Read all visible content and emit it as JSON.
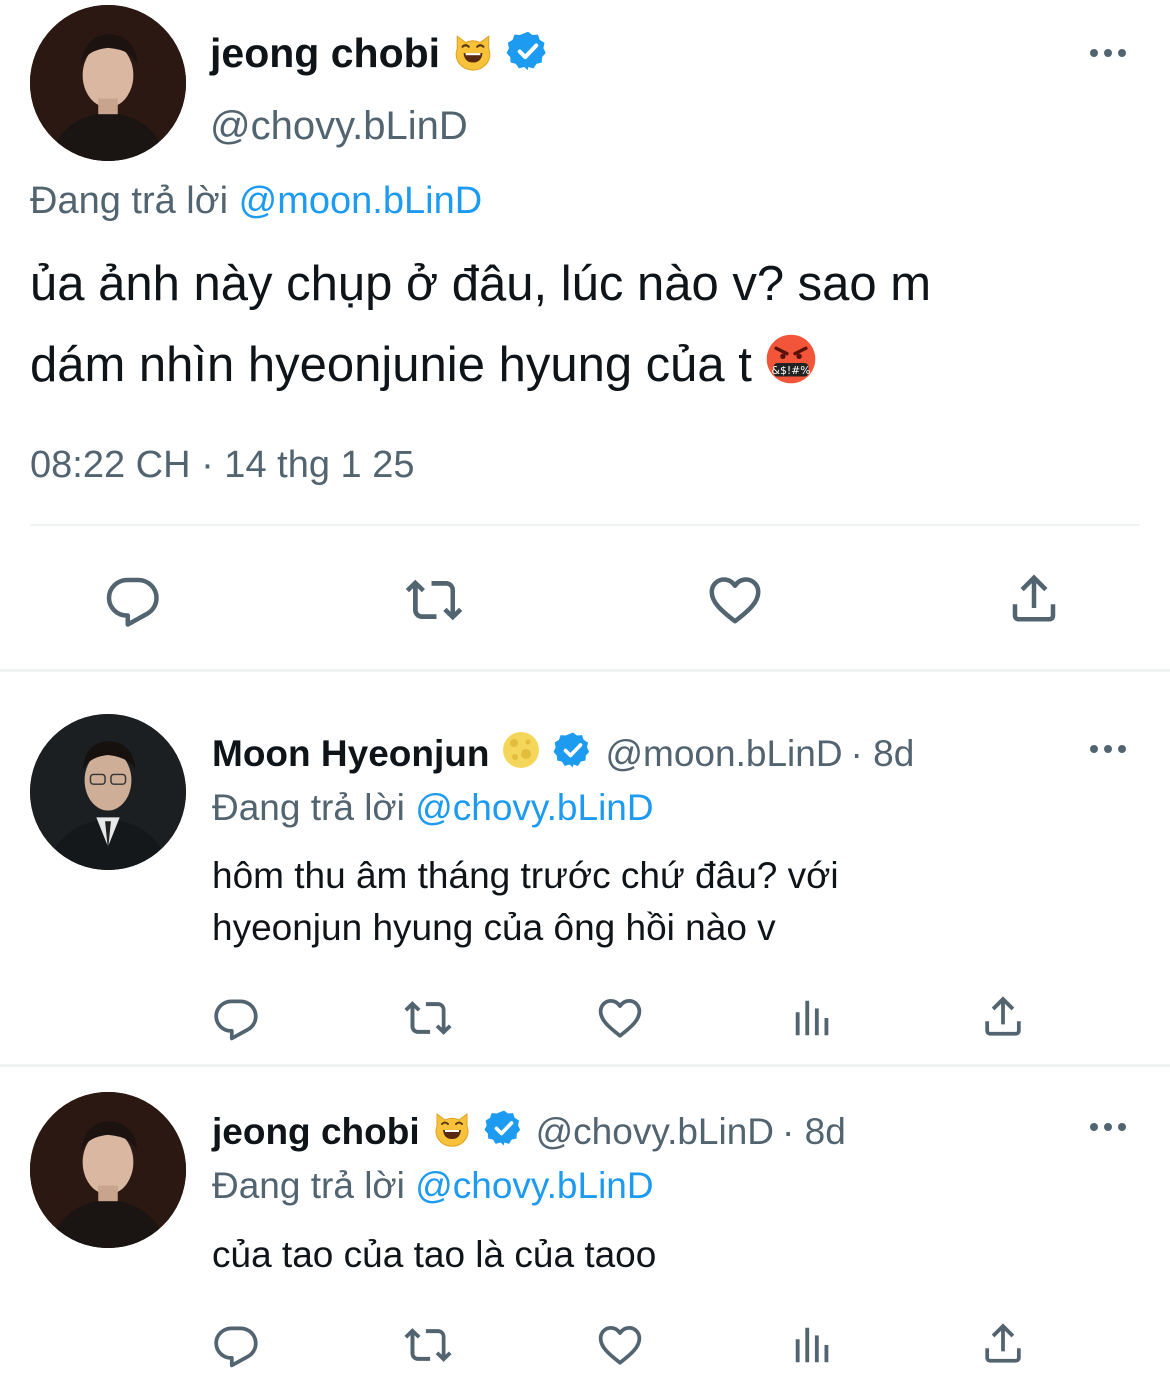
{
  "main_tweet": {
    "display_name": "jeong chobi",
    "name_emoji": "😺",
    "handle": "@chovy.bLinD",
    "reply_label": "Đang trả lời",
    "reply_to": "@moon.bLinD",
    "text_line1": "ủa ảnh này chụp ở đâu, lúc nào v? sao m",
    "text_line2": "dám nhìn hyeonjunie hyung của t",
    "text_emoji": "🤬",
    "timestamp": "08:22 CH · 14 thg 1 25"
  },
  "replies": [
    {
      "display_name": "Moon Hyeonjun",
      "name_emoji": "🌕",
      "handle": "@moon.bLinD",
      "age": "· 8d",
      "reply_label": "Đang trả lời",
      "reply_to": "@chovy.bLinD",
      "text_line1": "hôm thu âm tháng trước chứ đâu? với",
      "text_line2": "hyeonjun hyung của ông hồi nào v"
    },
    {
      "display_name": "jeong chobi",
      "name_emoji": "😺",
      "handle": "@chovy.bLinD",
      "age": "· 8d",
      "reply_label": "Đang trả lời",
      "reply_to": "@chovy.bLinD",
      "text_line1": "của tao của tao là của taoo"
    }
  ],
  "colors": {
    "accent": "#1d9bf0",
    "muted": "#536471",
    "text": "#0f1419",
    "divider": "#eff3f4"
  },
  "icons": [
    "reply-icon",
    "retweet-icon",
    "like-icon",
    "views-icon",
    "share-icon",
    "more-icon",
    "verified-badge-icon"
  ]
}
